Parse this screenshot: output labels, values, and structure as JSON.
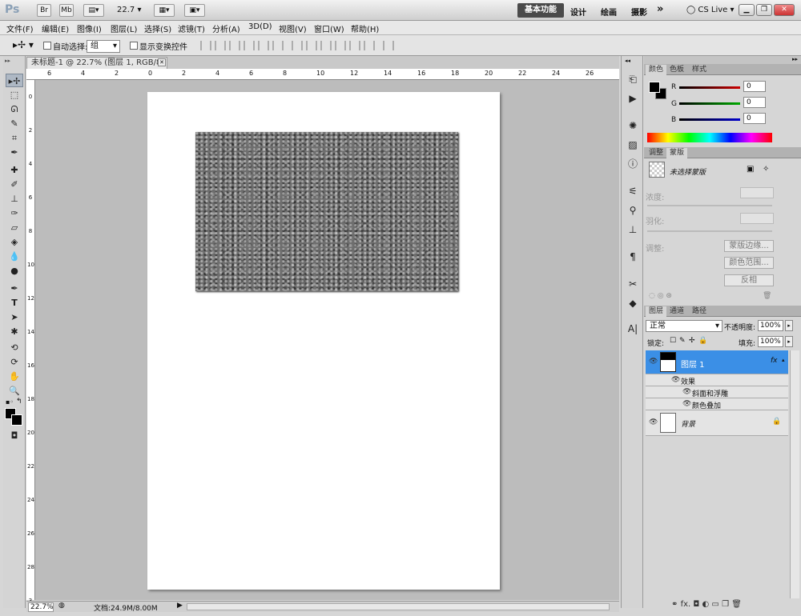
{
  "titlebar": {
    "logo": "Ps",
    "br": "Br",
    "mb": "Mb",
    "zoom": "22.7",
    "workspace_active": "基本功能",
    "workspaces": [
      "设计",
      "绘画",
      "摄影"
    ],
    "more": "»",
    "cslive": "CS Live"
  },
  "menu": [
    "文件(F)",
    "编辑(E)",
    "图像(I)",
    "图层(L)",
    "选择(S)",
    "滤镜(T)",
    "分析(A)",
    "3D(D)",
    "视图(V)",
    "窗口(W)",
    "帮助(H)"
  ],
  "options": {
    "auto_select_label": "自动选择:",
    "group_value": "组",
    "show_transform_label": "显示变换控件"
  },
  "document": {
    "tab_title": "未标题-1 @ 22.7% (图层 1, RGB/8) *",
    "ruler_h": [
      "6",
      "4",
      "2",
      "0",
      "2",
      "4",
      "6",
      "8",
      "10",
      "12",
      "14",
      "16",
      "18",
      "20",
      "22",
      "24",
      "26"
    ],
    "ruler_v": [
      "0",
      "2",
      "4",
      "6",
      "8",
      "10",
      "12",
      "14",
      "16",
      "18",
      "20",
      "22",
      "24",
      "26",
      "28",
      "3"
    ]
  },
  "status": {
    "zoom": "22.7%",
    "doc_size": "文档:24.9M/8.00M"
  },
  "color_panel": {
    "tabs": [
      "颜色",
      "色板",
      "样式"
    ],
    "channels": [
      {
        "name": "R",
        "value": "0",
        "color": "#cc0000"
      },
      {
        "name": "G",
        "value": "0",
        "color": "#00aa00"
      },
      {
        "name": "B",
        "value": "0",
        "color": "#0000cc"
      }
    ]
  },
  "mask_panel": {
    "tabs": [
      "调整",
      "蒙版"
    ],
    "no_mask": "未选择蒙版",
    "density": "浓度:",
    "feather": "羽化:",
    "refine": "调整:",
    "buttons": [
      "蒙版边缘...",
      "颜色范围...",
      "反相"
    ]
  },
  "layers_panel": {
    "tabs": [
      "图层",
      "通道",
      "路径"
    ],
    "blend_mode": "正常",
    "opacity_label": "不透明度:",
    "opacity": "100%",
    "lock_label": "锁定:",
    "fill_label": "填充:",
    "fill": "100%",
    "layers": [
      {
        "name": "图层 1",
        "selected": true,
        "fx": "fx"
      },
      {
        "name": "背景",
        "selected": false
      }
    ],
    "effects_label": "效果",
    "effects": [
      "斜面和浮雕",
      "颜色叠加"
    ]
  },
  "colors": {
    "selection": "#3b8fe6",
    "accent_dark": "#4a4a4a"
  }
}
